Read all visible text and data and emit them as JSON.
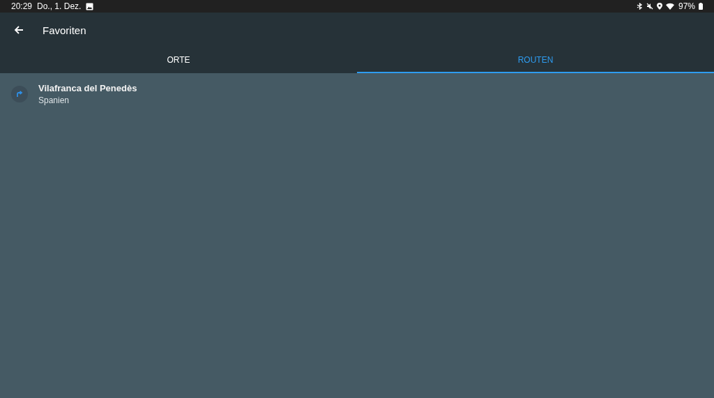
{
  "status_bar": {
    "time": "20:29",
    "date": "Do., 1. Dez.",
    "battery": "97%"
  },
  "app_bar": {
    "title": "Favoriten"
  },
  "tabs": [
    {
      "label": "ORTE",
      "selected": false
    },
    {
      "label": "ROUTEN",
      "selected": true
    }
  ],
  "routes": [
    {
      "name": "Vilafranca del Penedès",
      "country": "Spanien"
    }
  ]
}
